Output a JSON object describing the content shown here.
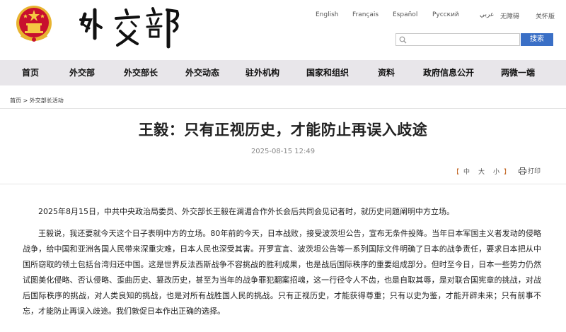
{
  "header": {
    "logo_text": "外交部",
    "languages": [
      "English",
      "Français",
      "Español",
      "Русский",
      "عربي",
      "无障碍",
      "关怀版"
    ],
    "search": {
      "placeholder": "",
      "button_label": "搜索"
    }
  },
  "nav": {
    "items": [
      "首页",
      "外交部",
      "外交部长",
      "外交动态",
      "驻外机构",
      "国家和组织",
      "资料",
      "政府信息公开",
      "两微一端"
    ]
  },
  "breadcrumb": {
    "home": "首页",
    "separator": ">",
    "current": "外交部长活动"
  },
  "article": {
    "title": "王毅：只有正视历史，才能防止再误入歧途",
    "date": "2025-08-15 12:49",
    "size_controls": {
      "open": "【",
      "large": "中",
      "medium": "大",
      "small": "小",
      "close": "】"
    },
    "print_label": "打印",
    "paragraphs": [
      "2025年8月15日，中共中央政治局委员、外交部长王毅在澜湄合作外长会后共同会见记者时，就历史问题阐明中方立场。",
      "王毅说，我还要就今天这个日子表明中方的立场。80年前的今天，日本战败，接受波茨坦公告，宣布无条件投降。当年日本军国主义者发动的侵略战争，给中国和亚洲各国人民带来深重灾难，日本人民也深受其害。开罗宣言、波茨坦公告等一系列国际文件明确了日本的战争责任，要求日本把从中国所窃取的领土包括台湾归还中国。这是世界反法西斯战争不容挑战的胜利成果，也是战后国际秩序的重要组成部分。但时至今日，日本一些势力仍然试图美化侵略、否认侵略、歪曲历史、篡改历史，甚至为当年的战争罪犯翻案招魂，这一行径令人不齿，也是自取其辱，是对联合国宪章的挑战，对战后国际秩序的挑战，对人类良知的挑战，也是对所有战胜国人民的挑战。只有正视历史，才能获得尊重；只有以史为鉴，才能开辟未来；只有前事不忘，才能防止再误入歧途。我们敦促日本作出正确的选择。"
    ]
  },
  "colors": {
    "nav_bg": "#e8e6ea",
    "search_btn": "#3a6fc6",
    "emblem_red": "#c8102e",
    "emblem_gold": "#e8b430"
  }
}
